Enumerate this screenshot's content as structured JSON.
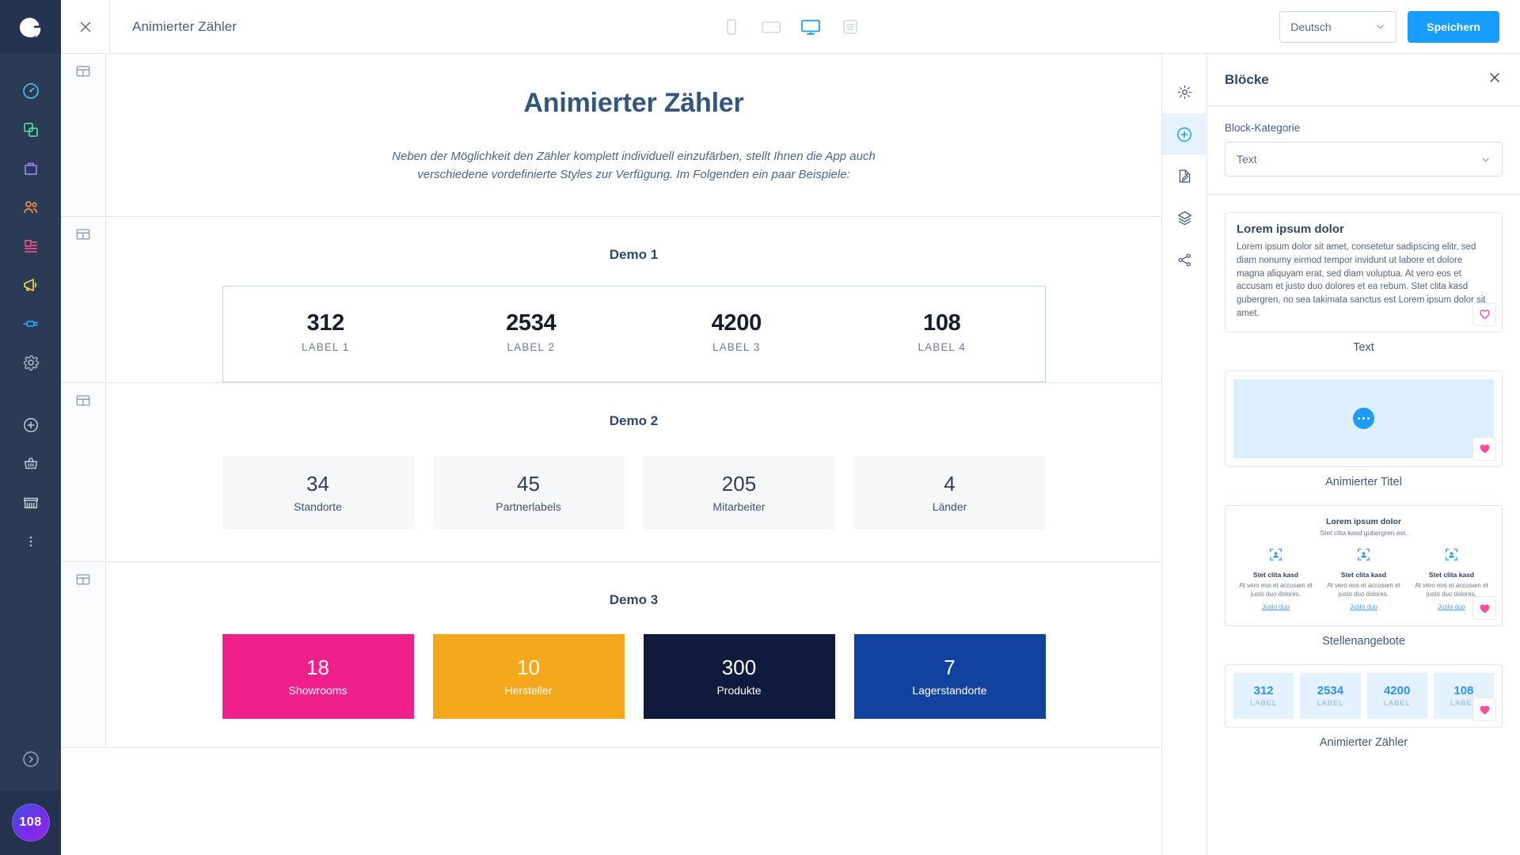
{
  "sidebar": {
    "logo_alt": "shopware-logo",
    "items": [
      {
        "name": "dashboard",
        "icon": "gauge-icon",
        "color": "#4fc2e8"
      },
      {
        "name": "catalogues",
        "icon": "layers-copy-icon",
        "color": "#4fd89b"
      },
      {
        "name": "orders",
        "icon": "briefcase-icon",
        "color": "#9a7ef0"
      },
      {
        "name": "customers",
        "icon": "users-icon",
        "color": "#f78b4a"
      },
      {
        "name": "content",
        "icon": "content-icon",
        "color": "#ee4f93"
      },
      {
        "name": "marketing",
        "icon": "megaphone-icon",
        "color": "#f5d442"
      },
      {
        "name": "extensions",
        "icon": "plug-icon",
        "color": "#2ea2f7"
      },
      {
        "name": "settings",
        "icon": "gear-icon",
        "color": "#aeb9c9"
      }
    ],
    "secondary": [
      {
        "name": "add",
        "icon": "plus-circle-icon"
      },
      {
        "name": "basket",
        "icon": "basket-icon"
      },
      {
        "name": "store",
        "icon": "store-icon"
      },
      {
        "name": "more",
        "icon": "dots-vertical-icon"
      }
    ],
    "expand": {
      "name": "expand",
      "icon": "chevron-right-circle-icon"
    },
    "avatar_text": "108"
  },
  "topbar": {
    "close_icon": "close-icon",
    "title": "Animierter Zähler",
    "devices": [
      {
        "name": "mobile",
        "icon": "mobile-icon",
        "active": false
      },
      {
        "name": "tablet",
        "icon": "tablet-icon",
        "active": false
      },
      {
        "name": "desktop",
        "icon": "desktop-icon",
        "active": true
      },
      {
        "name": "form",
        "icon": "form-icon",
        "active": false
      }
    ],
    "language_value": "Deutsch",
    "save_label": "Speichern",
    "accent_color": "#189eff"
  },
  "canvas": {
    "section_icon": "section-layout-icon",
    "hero": {
      "title": "Animierter Zähler",
      "subtitle": "Neben der Möglichkeit den Zähler komplett individuell einzufärben, stellt Ihnen die App auch verschiedene vordefinierte Styles zur Verfügung. Im Folgenden ein paar Beispiele:"
    },
    "demo1": {
      "title": "Demo 1",
      "items": [
        {
          "value": "312",
          "label": "LABEL 1"
        },
        {
          "value": "2534",
          "label": "LABEL 2"
        },
        {
          "value": "4200",
          "label": "LABEL 3"
        },
        {
          "value": "108",
          "label": "LABEL 4"
        }
      ]
    },
    "demo2": {
      "title": "Demo 2",
      "items": [
        {
          "value": "34",
          "label": "Standorte"
        },
        {
          "value": "45",
          "label": "Partnerlabels"
        },
        {
          "value": "205",
          "label": "Mitarbeiter"
        },
        {
          "value": "4",
          "label": "Länder"
        }
      ]
    },
    "demo3": {
      "title": "Demo 3",
      "items": [
        {
          "value": "18",
          "label": "Showrooms",
          "color": "#ef1f8b"
        },
        {
          "value": "10",
          "label": "Hersteller",
          "color": "#f5a81c"
        },
        {
          "value": "300",
          "label": "Produkte",
          "color": "#101a3c"
        },
        {
          "value": "7",
          "label": "Lagerstandorte",
          "color": "#11439e"
        }
      ]
    }
  },
  "rail": {
    "items": [
      {
        "name": "settings",
        "icon": "gear-icon",
        "active": false
      },
      {
        "name": "blocks",
        "icon": "plus-circle-icon",
        "active": true
      },
      {
        "name": "edit",
        "icon": "document-edit-icon",
        "active": false
      },
      {
        "name": "layers",
        "icon": "layers-icon",
        "active": false
      },
      {
        "name": "share",
        "icon": "share-icon",
        "active": false
      }
    ]
  },
  "panel": {
    "title": "Blöcke",
    "close_icon": "close-icon",
    "category_label": "Block-Kategorie",
    "category_value": "Text",
    "blocks": [
      {
        "name": "Text",
        "kind": "text",
        "heading": "Lorem ipsum dolor",
        "body": "Lorem ipsum dolor sit amet, consetetur sadipscing elitr, sed diam nonumy eirmod tempor invidunt ut labore et dolore magna aliquyam erat, sed diam voluptua. At vero eos et accusam et justo duo dolores et ea rebum. Stet clita kasd gubergren, no sea takimata sanctus est Lorem ipsum dolor sit amet.",
        "favorite": false
      },
      {
        "name": "Animierter Titel",
        "kind": "animated-title",
        "favorite": true
      },
      {
        "name": "Stellenangebote",
        "kind": "jobs",
        "heading": "Lorem ipsum dolor",
        "subheading": "Stet clita kasd gubergren est.",
        "columns": [
          {
            "title": "Stet clita kasd",
            "text": "At vero eos et accusam et justo duo dolores.",
            "link": "Justo duo"
          },
          {
            "title": "Stet clita kasd",
            "text": "At vero eos et accusam et justo duo dolores.",
            "link": "Justo duo"
          },
          {
            "title": "Stet clita kasd",
            "text": "At vero eos et accusam et justo duo dolores.",
            "link": "Justo duo"
          }
        ],
        "favorite": true
      },
      {
        "name": "Animierter Zähler",
        "kind": "counter",
        "items": [
          {
            "value": "312",
            "label": "LABEL"
          },
          {
            "value": "2534",
            "label": "LABEL"
          },
          {
            "value": "4200",
            "label": "LABEL"
          },
          {
            "value": "108",
            "label": "LABEL"
          }
        ],
        "favorite": true
      }
    ]
  }
}
